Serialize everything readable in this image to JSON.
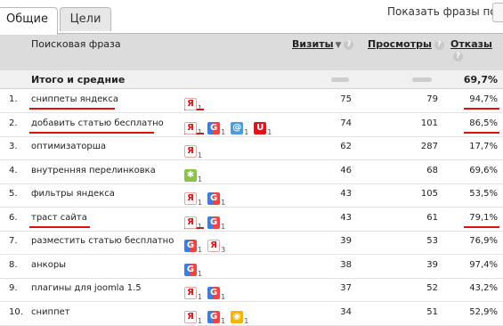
{
  "tabs": [
    {
      "label": "Общие",
      "active": true
    },
    {
      "label": "Цели",
      "active": false
    }
  ],
  "show_phrases_label": "Показать фразы по",
  "columns": {
    "phrase": "Поисковая фраза",
    "visits": "Визиты",
    "views": "Просмотры",
    "bounces": "Отказы",
    "help_glyph": "?",
    "sort_glyph": "▼"
  },
  "totals": {
    "label": "Итого и средние",
    "bounces": "69,7%"
  },
  "rows": [
    {
      "n": "1.",
      "phrase": "сниппеты яндекса",
      "visits": "75",
      "views": "79",
      "bounces": "94,7%",
      "icons": [
        {
          "name": "yandex",
          "count": "1"
        }
      ]
    },
    {
      "n": "2.",
      "phrase": "добавить статью бесплатно",
      "visits": "74",
      "views": "101",
      "bounces": "86,5%",
      "icons": [
        {
          "name": "yandex",
          "count": "1"
        },
        {
          "name": "google",
          "count": "1"
        },
        {
          "name": "rambler",
          "count": "1"
        },
        {
          "name": "shield",
          "count": "1"
        }
      ]
    },
    {
      "n": "3.",
      "phrase": "оптимизаторша",
      "visits": "62",
      "views": "287",
      "bounces": "17,7%",
      "icons": [
        {
          "name": "yandex",
          "count": "1"
        }
      ]
    },
    {
      "n": "4.",
      "phrase": "внутренняя перелинковка",
      "visits": "46",
      "views": "68",
      "bounces": "69,6%",
      "icons": [
        {
          "name": "bug",
          "count": "1"
        }
      ]
    },
    {
      "n": "5.",
      "phrase": "фильтры яндекса",
      "visits": "43",
      "views": "105",
      "bounces": "53,5%",
      "icons": [
        {
          "name": "yandex",
          "count": "1"
        },
        {
          "name": "google",
          "count": "1"
        }
      ]
    },
    {
      "n": "6.",
      "phrase": "траст сайта",
      "visits": "43",
      "views": "61",
      "bounces": "79,1%",
      "icons": [
        {
          "name": "yandex",
          "count": "1"
        },
        {
          "name": "google",
          "count": "1"
        }
      ]
    },
    {
      "n": "7.",
      "phrase": "разместить статью бесплатно",
      "visits": "39",
      "views": "53",
      "bounces": "76,9%",
      "icons": [
        {
          "name": "google",
          "count": "1"
        },
        {
          "name": "yandex",
          "count": "3"
        }
      ]
    },
    {
      "n": "8.",
      "phrase": "анкоры",
      "visits": "38",
      "views": "39",
      "bounces": "97,4%",
      "icons": [
        {
          "name": "google",
          "count": "1"
        }
      ]
    },
    {
      "n": "9.",
      "phrase": "плагины для joomla 1.5",
      "visits": "37",
      "views": "52",
      "bounces": "43,2%",
      "icons": [
        {
          "name": "yandex",
          "count": "1"
        },
        {
          "name": "google",
          "count": "1"
        }
      ]
    },
    {
      "n": "10.",
      "phrase": "сниппет",
      "visits": "34",
      "views": "51",
      "bounces": "52,9%",
      "icons": [
        {
          "name": "yandex",
          "count": "1"
        },
        {
          "name": "google",
          "count": "1"
        },
        {
          "name": "pin",
          "count": "1"
        }
      ]
    }
  ],
  "icon_glyphs": {
    "yandex": "Я",
    "google": "G",
    "rambler": "@",
    "shield": "U",
    "bug": "✱",
    "pin": "◉"
  },
  "colors": {
    "underline": "#e01010",
    "header_bg": "#dcdcdc",
    "yandex": "#d11111",
    "google": "#3b7de0"
  }
}
